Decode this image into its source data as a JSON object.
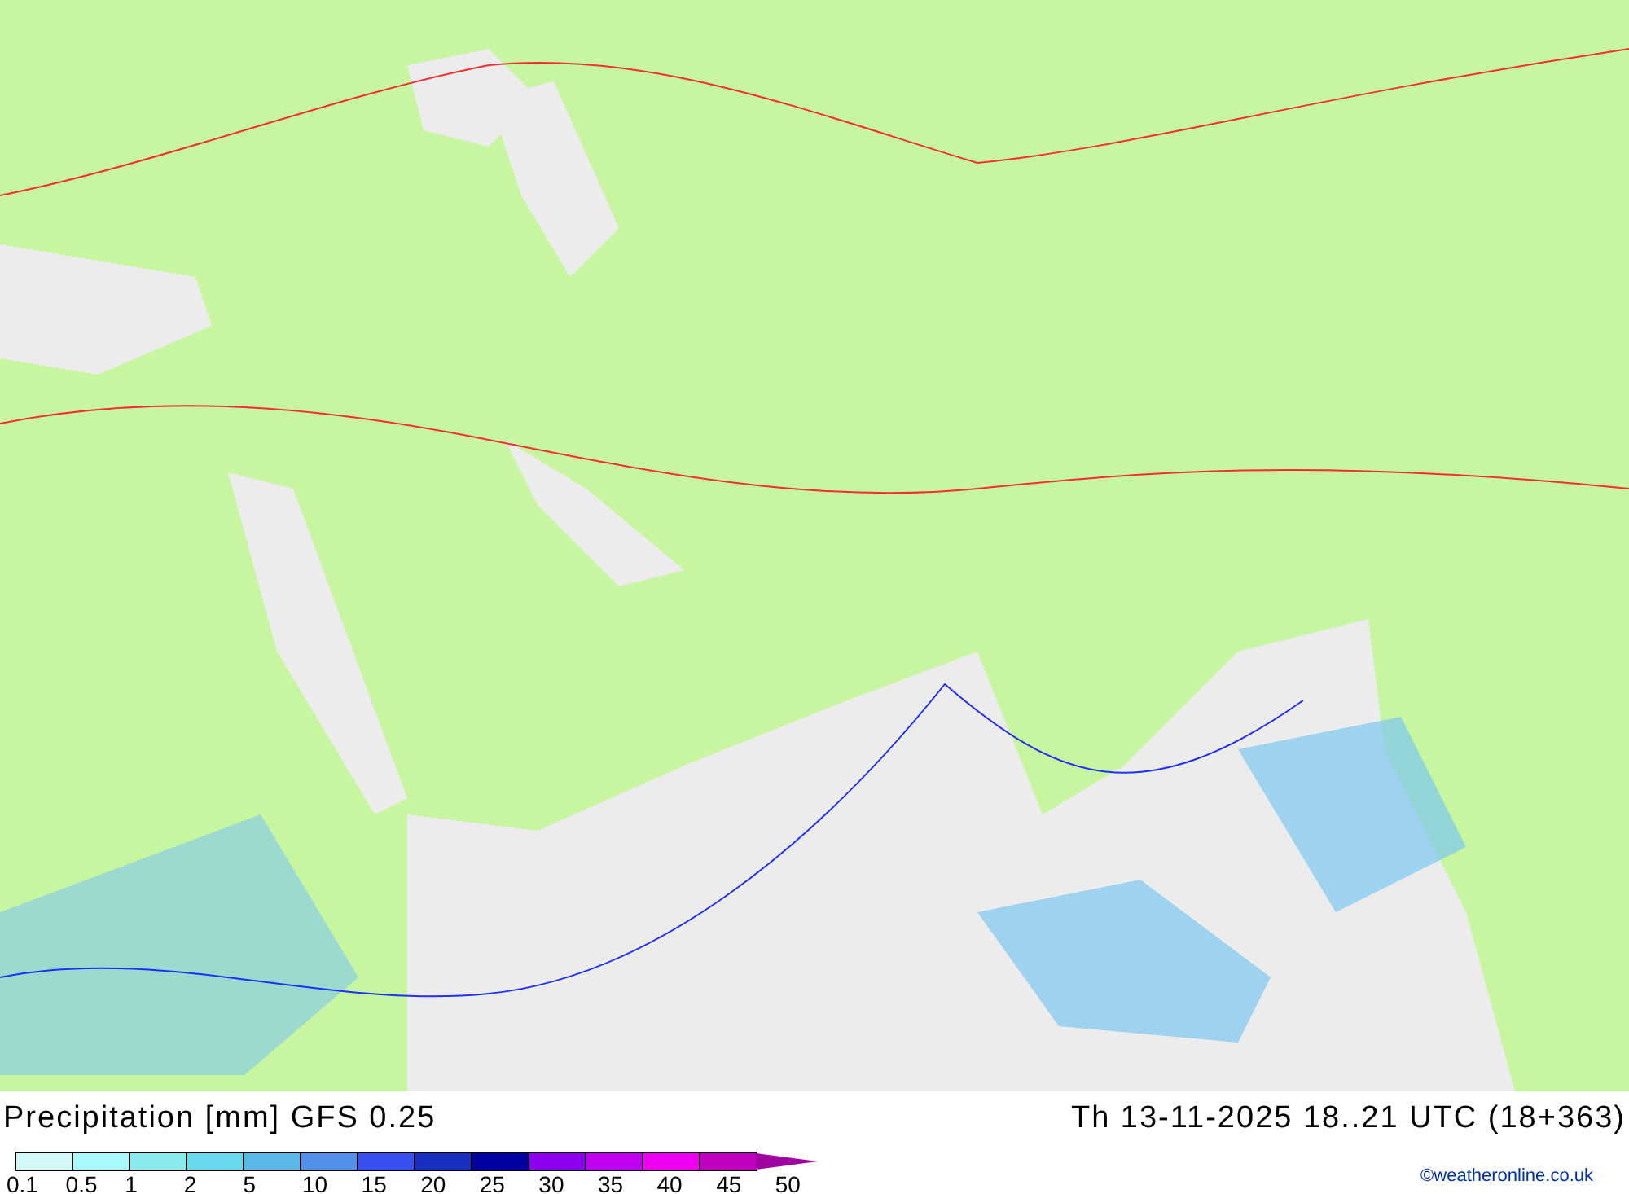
{
  "title": "Precipitation [mm] GFS 0.25",
  "valid_time": "Th 13-11-2025 18..21 UTC (18+363)",
  "legend": {
    "swatches": [
      {
        "color": "#d2f8f8"
      },
      {
        "color": "#a8fafa"
      },
      {
        "color": "#8aeaea"
      },
      {
        "color": "#68d8ec"
      },
      {
        "color": "#58b8e8"
      },
      {
        "color": "#5090e8"
      },
      {
        "color": "#3850f0"
      },
      {
        "color": "#1830c0"
      },
      {
        "color": "#0000a0"
      },
      {
        "color": "#8c00f0"
      },
      {
        "color": "#c000f0"
      },
      {
        "color": "#f000f0"
      },
      {
        "color": "#c000c0"
      }
    ],
    "labels": [
      "0.1",
      "0.5",
      "1",
      "2",
      "5",
      "10",
      "15",
      "20",
      "25",
      "30",
      "35",
      "40",
      "45",
      "50"
    ]
  },
  "credit": "©weatheronline.co.uk"
}
